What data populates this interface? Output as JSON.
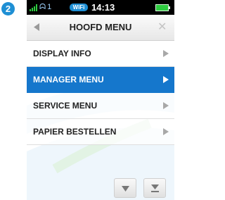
{
  "step": "2",
  "status_bar": {
    "connection_text": "ᗣ 1",
    "wifi_label": "WiFi",
    "time": "14:13"
  },
  "header": {
    "title": "HOOFD MENU"
  },
  "menu": {
    "items": [
      {
        "label": "DISPLAY INFO"
      },
      {
        "label": "MANAGER MENU"
      },
      {
        "label": "SERVICE MENU"
      },
      {
        "label": "PAPIER BESTELLEN"
      }
    ]
  },
  "colors": {
    "accent": "#1577cc",
    "badge": "#1e8fd4",
    "battery": "#2ecc40"
  },
  "icons": {
    "back": "left-triangle-icon",
    "close": "close-icon",
    "chevron": "right-triangle-icon",
    "scroll_down": "down-triangle-icon",
    "scroll_end": "down-to-bottom-icon"
  }
}
